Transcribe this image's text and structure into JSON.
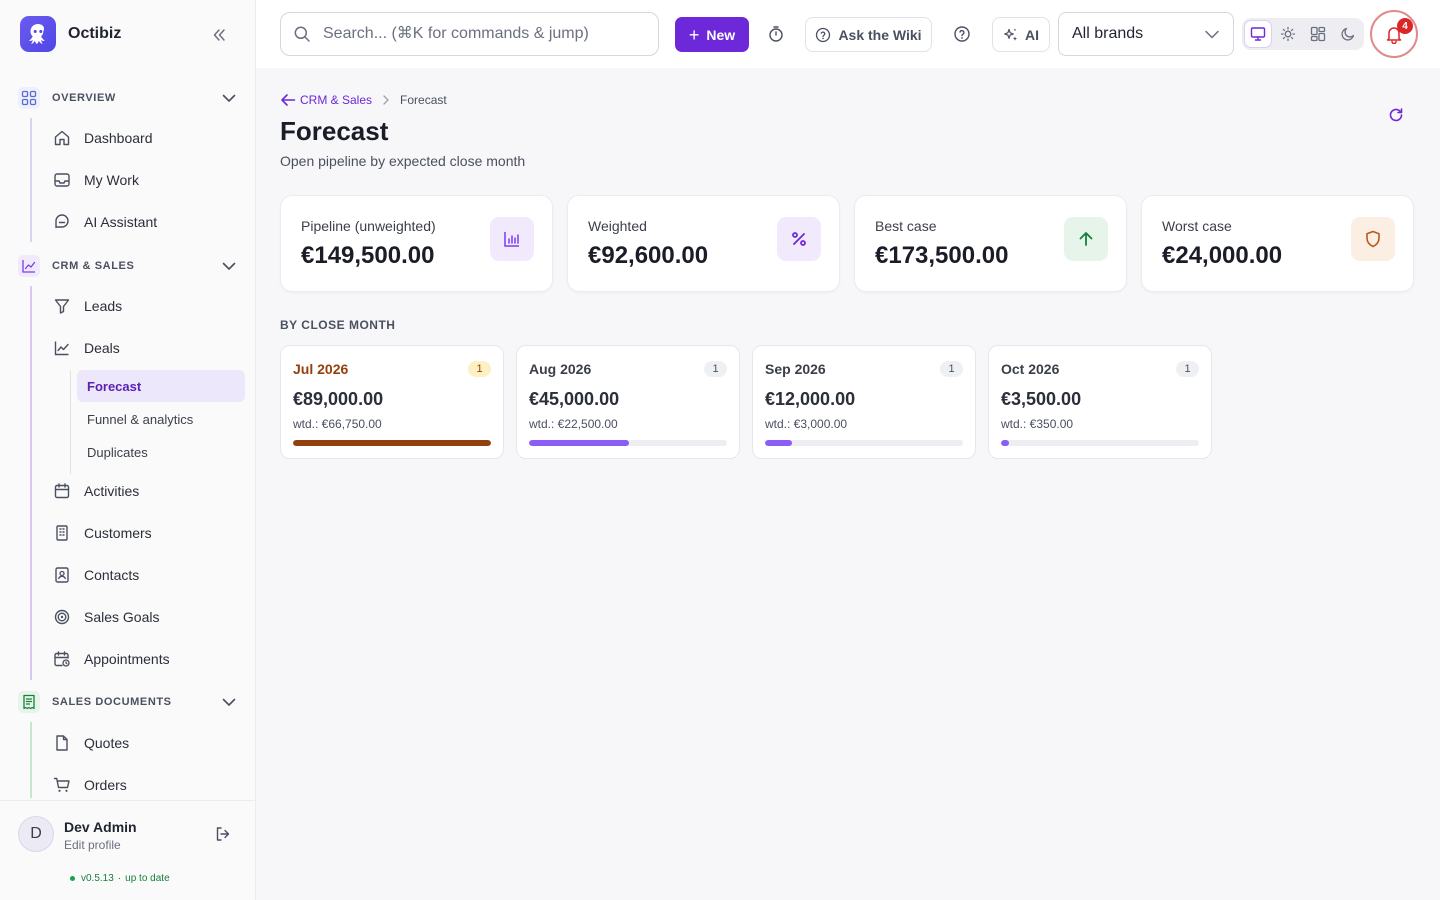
{
  "app": {
    "name": "Octibiz"
  },
  "sidebar": {
    "sections": [
      {
        "label": "OVERVIEW",
        "icon": "grid-icon",
        "items": [
          "Dashboard",
          "My Work",
          "AI Assistant"
        ]
      },
      {
        "label": "CRM & SALES",
        "icon": "chart-line-icon",
        "items": [
          "Leads",
          "Deals",
          "Activities",
          "Customers",
          "Contacts",
          "Sales Goals",
          "Appointments"
        ],
        "sub_items": [
          "Forecast",
          "Funnel & analytics",
          "Duplicates"
        ]
      },
      {
        "label": "SALES DOCUMENTS",
        "icon": "receipt-icon",
        "items": [
          "Quotes",
          "Orders"
        ]
      }
    ],
    "active_sub_item": "Forecast"
  },
  "user": {
    "name": "Dev Admin",
    "subtitle": "Edit profile",
    "initial": "D",
    "version": "v0.5.13",
    "version_status": "up to date"
  },
  "topbar": {
    "search_placeholder": "Search... (⌘K for commands & jump)",
    "new_label": "New",
    "wiki_label": "Ask the Wiki",
    "ai_label": "AI",
    "brand_select": "All brands",
    "notification_count": "4"
  },
  "page": {
    "breadcrumb_parent": "CRM & Sales",
    "breadcrumb_current": "Forecast",
    "title": "Forecast",
    "subtitle": "Open pipeline by expected close month",
    "section_label": "BY CLOSE MONTH"
  },
  "kpis": [
    {
      "label": "Pipeline (unweighted)",
      "value": "€149,500.00",
      "icon": "bar-chart-icon",
      "bg": "#f1eafd",
      "fg": "#7c3aed"
    },
    {
      "label": "Weighted",
      "value": "€92,600.00",
      "icon": "percent-icon",
      "bg": "#f1eafd",
      "fg": "#6d28d9"
    },
    {
      "label": "Best case",
      "value": "€173,500.00",
      "icon": "arrow-up-icon",
      "bg": "#e6f4ea",
      "fg": "#16803d"
    },
    {
      "label": "Worst case",
      "value": "€24,000.00",
      "icon": "shield-icon",
      "bg": "#fbeee2",
      "fg": "#c2551f"
    }
  ],
  "months": [
    {
      "label": "Jul 2026",
      "count": "1",
      "amount": "€89,000.00",
      "weighted": "wtd.: €66,750.00",
      "progress": 1.0,
      "highlight": true
    },
    {
      "label": "Aug 2026",
      "count": "1",
      "amount": "€45,000.00",
      "weighted": "wtd.: €22,500.00",
      "progress": 0.5056,
      "highlight": false
    },
    {
      "label": "Sep 2026",
      "count": "1",
      "amount": "€12,000.00",
      "weighted": "wtd.: €3,000.00",
      "progress": 0.1348,
      "highlight": false
    },
    {
      "label": "Oct 2026",
      "count": "1",
      "amount": "€3,500.00",
      "weighted": "wtd.: €350.00",
      "progress": 0.0393,
      "highlight": false
    }
  ],
  "colors": {
    "accent": "#6d28d9",
    "highlight_text": "#92400e",
    "highlight_bar": "#92400e",
    "highlight_badge": "#fdf0c2",
    "bar": "#8b5cf6"
  }
}
